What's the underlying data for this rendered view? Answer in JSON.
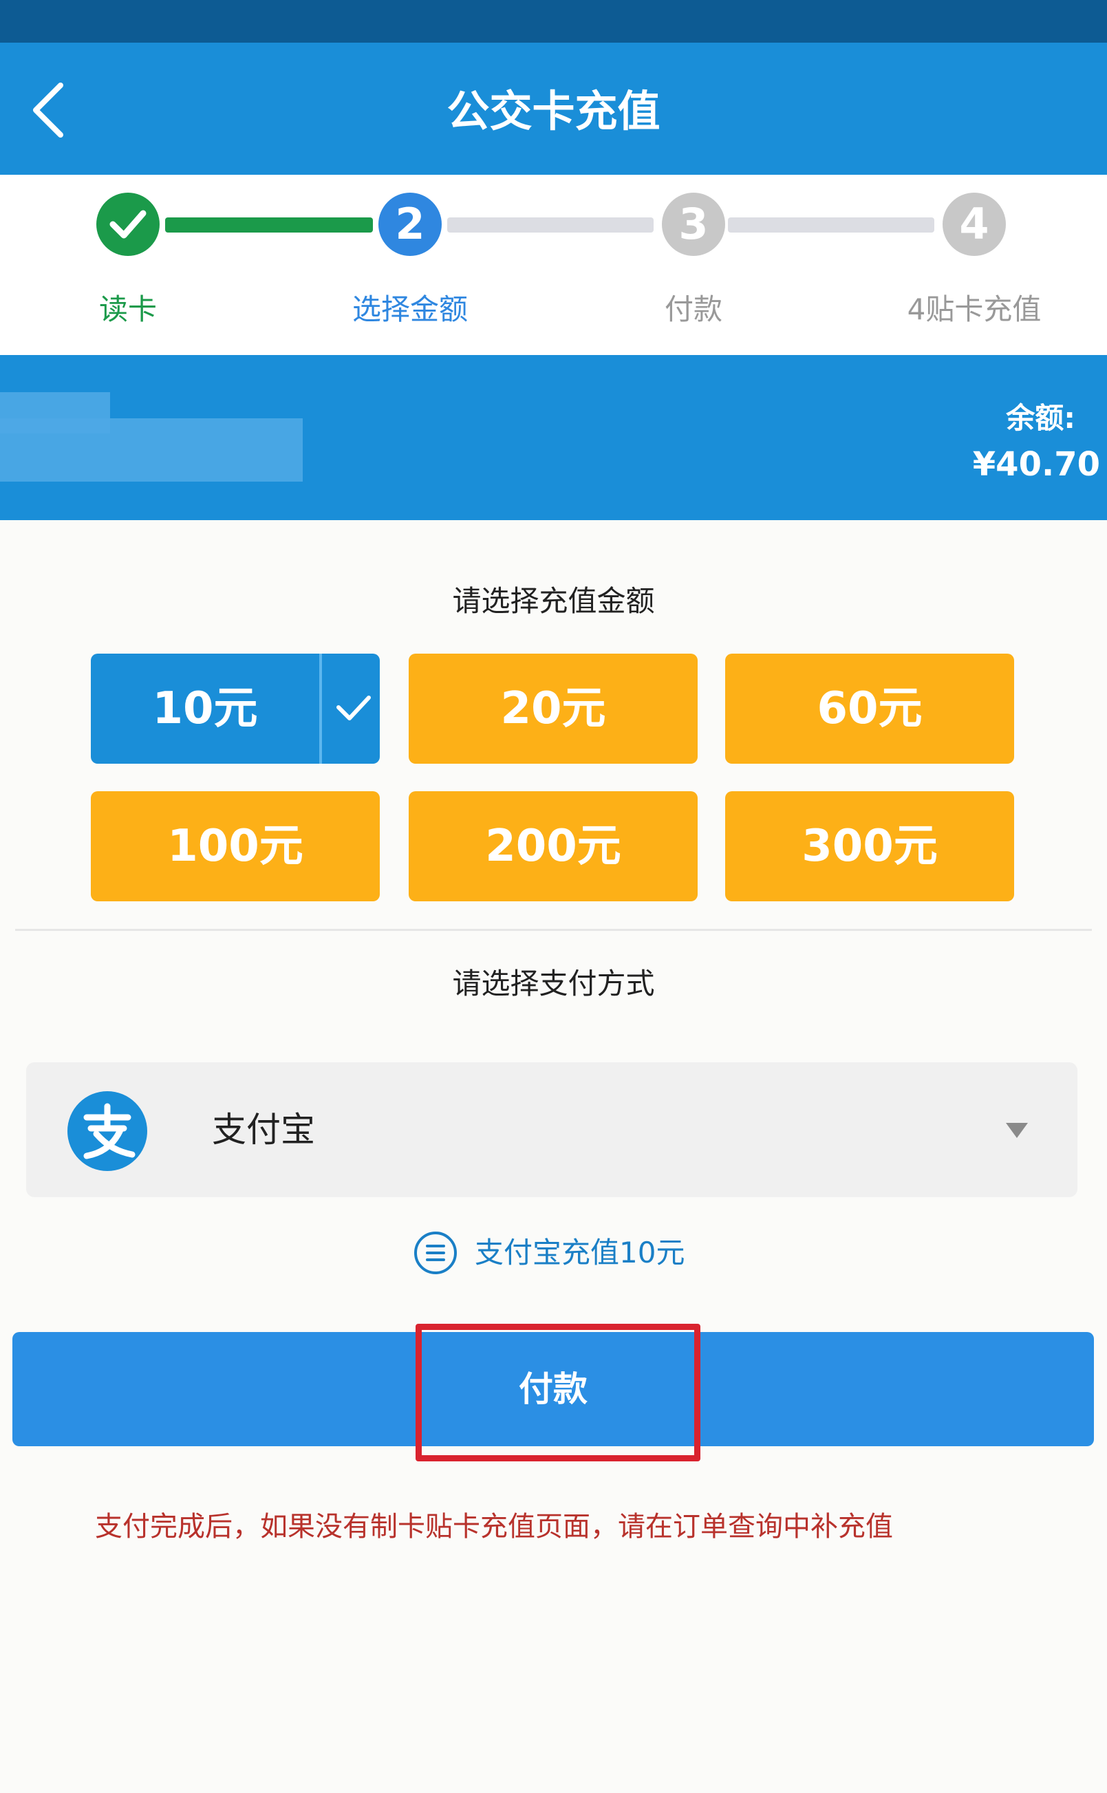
{
  "header": {
    "title": "公交卡充值",
    "back_icon": "chevron-left-icon"
  },
  "stepper": {
    "steps": [
      {
        "number": "✓",
        "label": "读卡",
        "state": "done",
        "color": "#1b9a4a"
      },
      {
        "number": "2",
        "label": "选择金额",
        "state": "active",
        "color": "#2f87e0"
      },
      {
        "number": "3",
        "label": "付款",
        "state": "pending",
        "color": "#c8c8c8"
      },
      {
        "number": "4",
        "label": "4贴卡充值",
        "state": "pending",
        "color": "#c8c8c8"
      }
    ]
  },
  "card": {
    "balance_label": "余额:",
    "balance_value": "¥40.70"
  },
  "amount_section": {
    "title": "请选择充值金额",
    "options": [
      "10元",
      "20元",
      "60元",
      "100元",
      "200元",
      "300元"
    ],
    "selected": "10元"
  },
  "payment_section": {
    "title": "请选择支付方式",
    "method": "支付宝",
    "icon": "alipay-icon"
  },
  "summary": {
    "text": "支付宝充值10元"
  },
  "pay_button": {
    "label": "付款"
  },
  "footer": {
    "note": "支付完成后，如果没有制卡贴卡充值页面，请在订单查询中补充值"
  },
  "colors": {
    "primary": "#1a8ed8",
    "amount": "#fdb017",
    "done": "#1b9a4a",
    "highlight": "#d9232f"
  }
}
